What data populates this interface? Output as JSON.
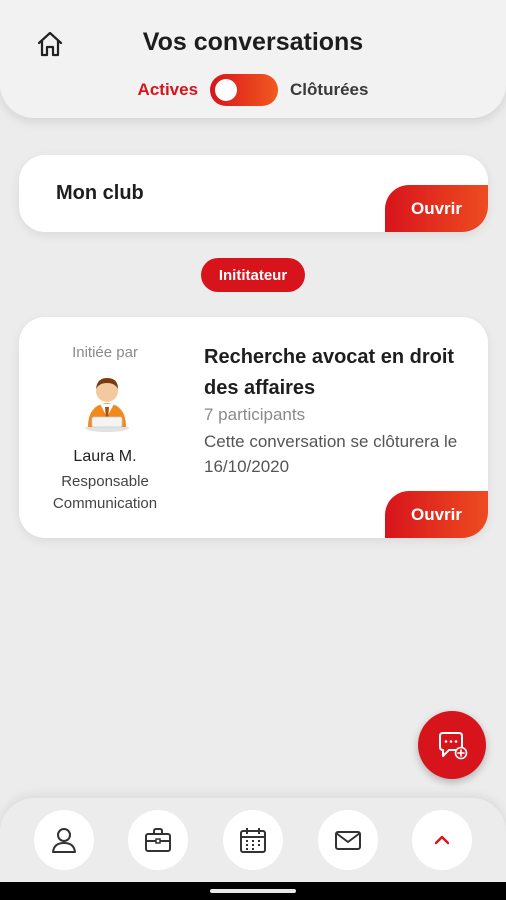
{
  "header": {
    "title": "Vos conversations",
    "toggle": {
      "left_label": "Actives",
      "right_label": "Clôturées",
      "active": "Actives"
    },
    "home_icon": "home-icon"
  },
  "club_card": {
    "name": "Mon club",
    "open_label": "Ouvrir"
  },
  "badge": {
    "label": "Inititateur"
  },
  "conversation": {
    "initiated_label": "Initiée par",
    "initiator_name": "Laura M.",
    "initiator_role_line1": "Responsable",
    "initiator_role_line2": "Communication",
    "title": "Recherche avocat en droit des affaires",
    "participants": "7 participants",
    "close_info": "Cette conversation se clôturera le 16/10/2020",
    "open_label": "Ouvrir"
  },
  "fab": {
    "icon": "new-chat-icon"
  },
  "bottom_nav": {
    "items": [
      {
        "icon": "user-icon"
      },
      {
        "icon": "briefcase-icon"
      },
      {
        "icon": "calendar-icon"
      },
      {
        "icon": "mail-icon"
      },
      {
        "icon": "chevron-up-icon"
      }
    ]
  },
  "colors": {
    "accent": "#d7141c",
    "accent_gradient_end": "#f25a1e",
    "background": "#ececec"
  }
}
